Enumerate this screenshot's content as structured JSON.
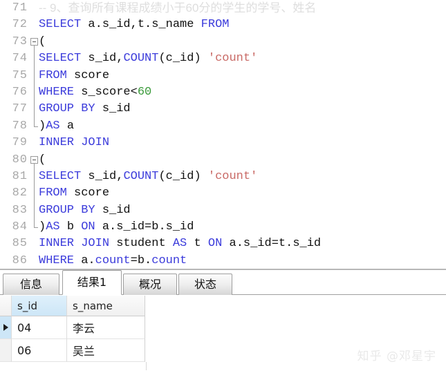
{
  "editor": {
    "first_line_number": 71,
    "colors": {
      "keyword": "#3b3bdb",
      "identifier": "#111111",
      "number": "#3a9a3a",
      "string": "#c96a66",
      "comment": "#dedede",
      "gutter": "#a8a8a8",
      "background": "#ffffff"
    },
    "lines": [
      {
        "num": "71",
        "text": "-- 9、查询所有课程成绩小于60分的学生的学号、姓名"
      },
      {
        "num": "72",
        "text": "SELECT a.s_id,t.s_name FROM"
      },
      {
        "num": "73",
        "text": "("
      },
      {
        "num": "74",
        "text": "SELECT s_id,COUNT(c_id) 'count'"
      },
      {
        "num": "75",
        "text": "FROM score"
      },
      {
        "num": "76",
        "text": "WHERE s_score<60"
      },
      {
        "num": "77",
        "text": "GROUP BY s_id"
      },
      {
        "num": "78",
        "text": ")AS a"
      },
      {
        "num": "79",
        "text": "INNER JOIN"
      },
      {
        "num": "80",
        "text": "("
      },
      {
        "num": "81",
        "text": "SELECT s_id,COUNT(c_id) 'count'"
      },
      {
        "num": "82",
        "text": "FROM score"
      },
      {
        "num": "83",
        "text": "GROUP BY s_id"
      },
      {
        "num": "84",
        "text": ")AS b ON a.s_id=b.s_id"
      },
      {
        "num": "85",
        "text": "INNER JOIN student AS t ON a.s_id=t.s_id"
      },
      {
        "num": "86",
        "text": "WHERE a.count=b.count"
      }
    ],
    "fold_regions": [
      {
        "start_line": "73",
        "end_line": "78",
        "state": "expanded"
      },
      {
        "start_line": "80",
        "end_line": "84",
        "state": "expanded"
      }
    ]
  },
  "tabs": {
    "items": [
      {
        "label": "信息",
        "active": false
      },
      {
        "label": "结果1",
        "active": true
      },
      {
        "label": "概况",
        "active": false
      },
      {
        "label": "状态",
        "active": false
      }
    ]
  },
  "result_grid": {
    "columns": [
      {
        "label": "s_id",
        "selected": true
      },
      {
        "label": "s_name",
        "selected": false
      }
    ],
    "rows": [
      {
        "current": true,
        "s_id": "04",
        "s_name": "李云"
      },
      {
        "current": false,
        "s_id": "06",
        "s_name": "吴兰"
      }
    ]
  },
  "watermark": {
    "text": "知乎 @邓星宇"
  }
}
